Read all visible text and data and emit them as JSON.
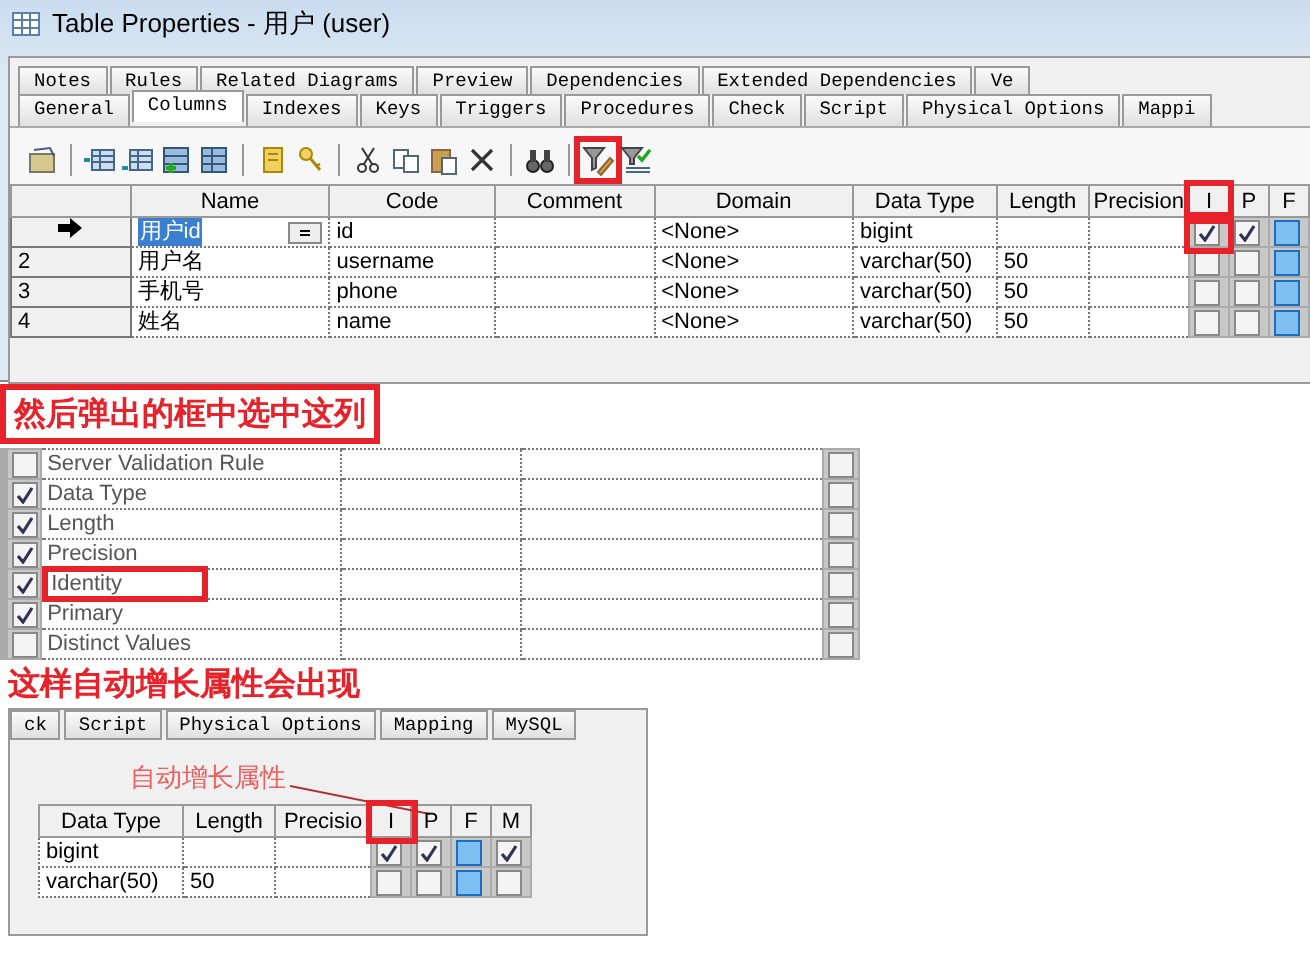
{
  "window": {
    "title": "Table Properties - 用户 (user)"
  },
  "tab_rows": [
    [
      {
        "label": "Notes",
        "selected": false
      },
      {
        "label": "Rules",
        "selected": false
      },
      {
        "label": "Related Diagrams",
        "selected": false
      },
      {
        "label": "Preview",
        "selected": false
      },
      {
        "label": "Dependencies",
        "selected": false
      },
      {
        "label": "Extended Dependencies",
        "selected": false
      },
      {
        "label": "Ve",
        "selected": false
      }
    ],
    [
      {
        "label": "General",
        "selected": false
      },
      {
        "label": "Columns",
        "selected": true
      },
      {
        "label": "Indexes",
        "selected": false
      },
      {
        "label": "Keys",
        "selected": false
      },
      {
        "label": "Triggers",
        "selected": false
      },
      {
        "label": "Procedures",
        "selected": false
      },
      {
        "label": "Check",
        "selected": false
      },
      {
        "label": "Script",
        "selected": false
      },
      {
        "label": "Physical Options",
        "selected": false
      },
      {
        "label": "Mappi",
        "selected": false
      }
    ]
  ],
  "grid": {
    "columns": [
      "Name",
      "Code",
      "Comment",
      "Domain",
      "Data Type",
      "Length",
      "Precision",
      "I",
      "P",
      "F"
    ],
    "rows": [
      {
        "current": true,
        "name": "用户id",
        "code": "id",
        "domain": "<None>",
        "data_type": "bigint",
        "identity": true,
        "primary": true,
        "foreign": false
      },
      {
        "current": false,
        "number": "2",
        "name": "用户名",
        "code": "username",
        "domain": "<None>",
        "data_type": "varchar(50)",
        "length": "50",
        "identity": false,
        "primary": false,
        "foreign": false
      },
      {
        "current": false,
        "number": "3",
        "name": "手机号",
        "code": "phone",
        "domain": "<None>",
        "data_type": "varchar(50)",
        "length": "50",
        "identity": false,
        "primary": false,
        "foreign": false
      },
      {
        "current": false,
        "number": "4",
        "name": "姓名",
        "code": "name",
        "domain": "<None>",
        "data_type": "varchar(50)",
        "length": "50",
        "identity": false,
        "primary": false,
        "foreign": false
      }
    ]
  },
  "caption_1": "然后弹出的框中选中这列",
  "column_list": [
    {
      "label": "Server Validation Rule",
      "checked": false,
      "column_5_checked": false
    },
    {
      "label": "Data Type",
      "checked": true,
      "column_5_checked": false
    },
    {
      "label": "Length",
      "checked": true,
      "column_5_checked": false
    },
    {
      "label": "Precision",
      "checked": true,
      "column_5_checked": false
    },
    {
      "label": "Identity",
      "checked": true,
      "column_5_checked": false
    },
    {
      "label": "Primary",
      "checked": true,
      "column_5_checked": false
    },
    {
      "label": "Distinct Values",
      "checked": false,
      "column_5_checked": false
    }
  ],
  "caption_2": "这样自动增长属性会出现",
  "result": {
    "tabs": [
      "ck",
      "Script",
      "Physical Options",
      "Mapping",
      "MySQL"
    ],
    "callout": "自动增长属性",
    "columns": [
      "Data Type",
      "Length",
      "Precisio",
      "I",
      "P",
      "F",
      "M"
    ],
    "rows": [
      {
        "data_type": "bigint",
        "identity": true,
        "primary": true,
        "foreign": false,
        "mandatory": true
      },
      {
        "data_type": "varchar(50)",
        "length": "50",
        "identity": false,
        "primary": false,
        "foreign": false,
        "mandatory": false
      }
    ]
  }
}
